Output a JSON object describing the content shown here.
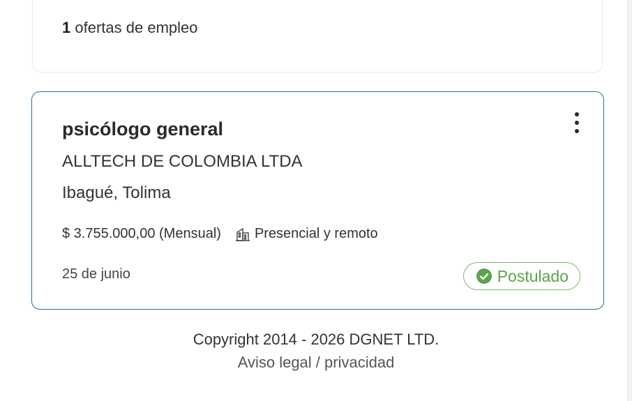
{
  "summary": {
    "count": "1",
    "label": "ofertas de empleo"
  },
  "job": {
    "title": "psicólogo general",
    "company": "ALLTECH DE COLOMBIA LTDA",
    "location": "Ibagué, Tolima",
    "salary": "$ 3.755.000,00 (Mensual)",
    "modality": "Presencial y remoto",
    "modality_icon": "building-icon",
    "date": "25 de junio",
    "status": "Postulado",
    "status_icon": "check-circle-icon",
    "status_color": "#5aa449",
    "border_color": "#2f6a8a"
  },
  "footer": {
    "copyright": "Copyright 2014 - 2026 DGNET LTD.",
    "legal_link": "Aviso legal",
    "separator": " / ",
    "privacy_link": "privacidad"
  }
}
